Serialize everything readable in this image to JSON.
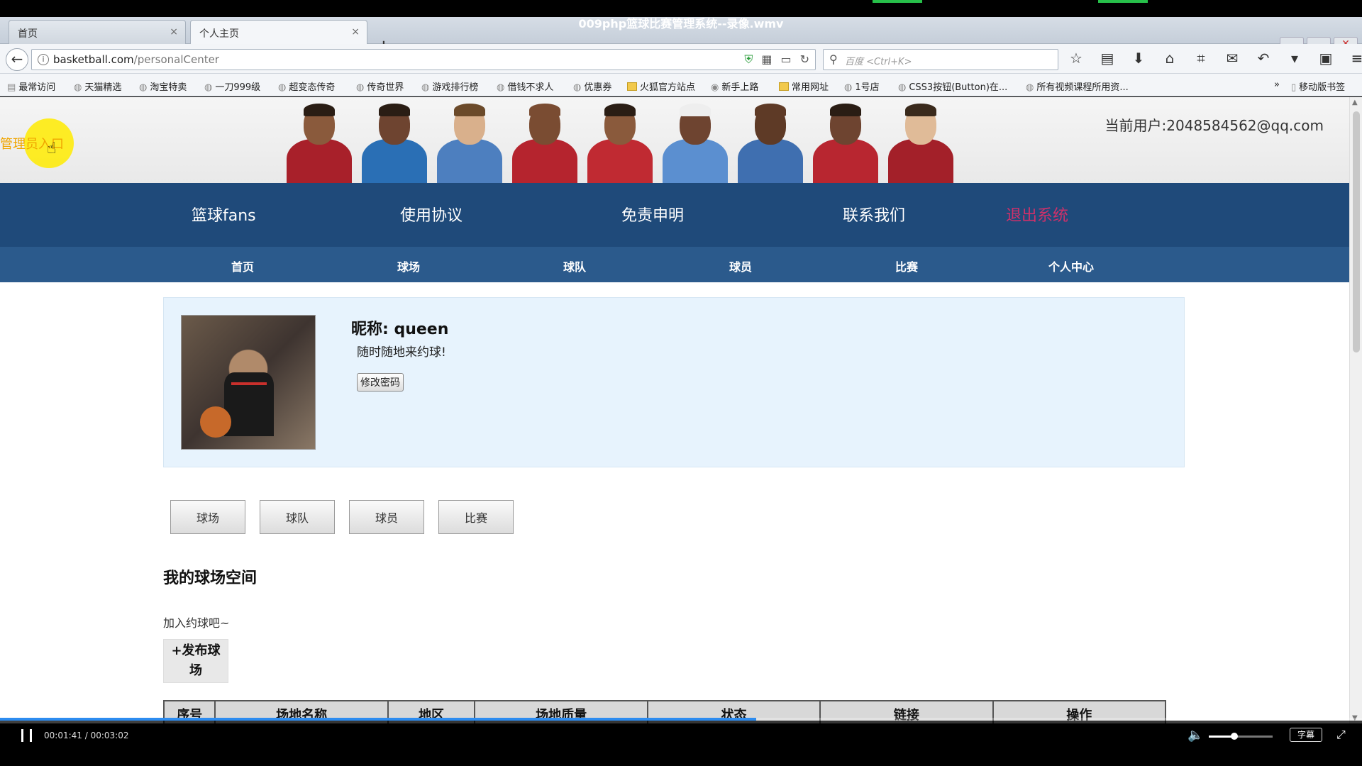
{
  "player": {
    "title": "009php篮球比赛管理系统--录像.wmv",
    "time": "00:01:41 / 00:03:02",
    "progress": 0.555,
    "volume": 0.4,
    "subs_label": "字幕",
    "pause_icon": "pause-icon",
    "volume_icon": "volume-icon",
    "fullscreen_icon": "fullscreen-icon"
  },
  "browser": {
    "tabs": [
      {
        "label": "首页",
        "active": false
      },
      {
        "label": "个人主页",
        "active": true
      }
    ],
    "url_host": "basketball.com",
    "url_path": "/personalCenter",
    "search_placeholder": "百度 <Ctrl+K>",
    "bookmarks": [
      "最常访问",
      "天猫精选",
      "淘宝特卖",
      "一刀999级",
      "超变态传奇",
      "传奇世界",
      "游戏排行榜",
      "借钱不求人",
      "优惠券",
      "火狐官方站点",
      "新手上路",
      "常用网址",
      "1号店",
      "CSS3按钮(Button)在...",
      "所有视频课程所用资..."
    ],
    "mobile_bookmarks": "移动版书签",
    "overflow": "»"
  },
  "site": {
    "admin_link": "管理员入口",
    "current_user": "当前用户:2048584562@qq.com",
    "main_nav": [
      "篮球fans",
      "使用协议",
      "免责申明",
      "联系我们",
      "退出系统"
    ],
    "sub_nav": [
      "首页",
      "球场",
      "球队",
      "球员",
      "比赛",
      "个人中心"
    ],
    "profile": {
      "nickname": "昵称: queen",
      "motto": "随时随地来约球!",
      "change_password": "修改密码"
    },
    "tabs": [
      "球场",
      "球队",
      "球员",
      "比赛"
    ],
    "section_title": "我的球场空间",
    "section_desc": "加入约球吧~",
    "publish_button": "+发布球场",
    "table_headers": [
      "序号",
      "场地名称",
      "地区",
      "场地质量",
      "状态",
      "链接",
      "操作"
    ]
  },
  "colors": {
    "main_nav_bg": "#1f4a7a",
    "sub_nav_bg": "#2b5a8c",
    "logout": "#d0306a",
    "admin_link": "#f0a500",
    "profile_bg": "#e7f3fd",
    "progress": "#2d8cf0"
  }
}
